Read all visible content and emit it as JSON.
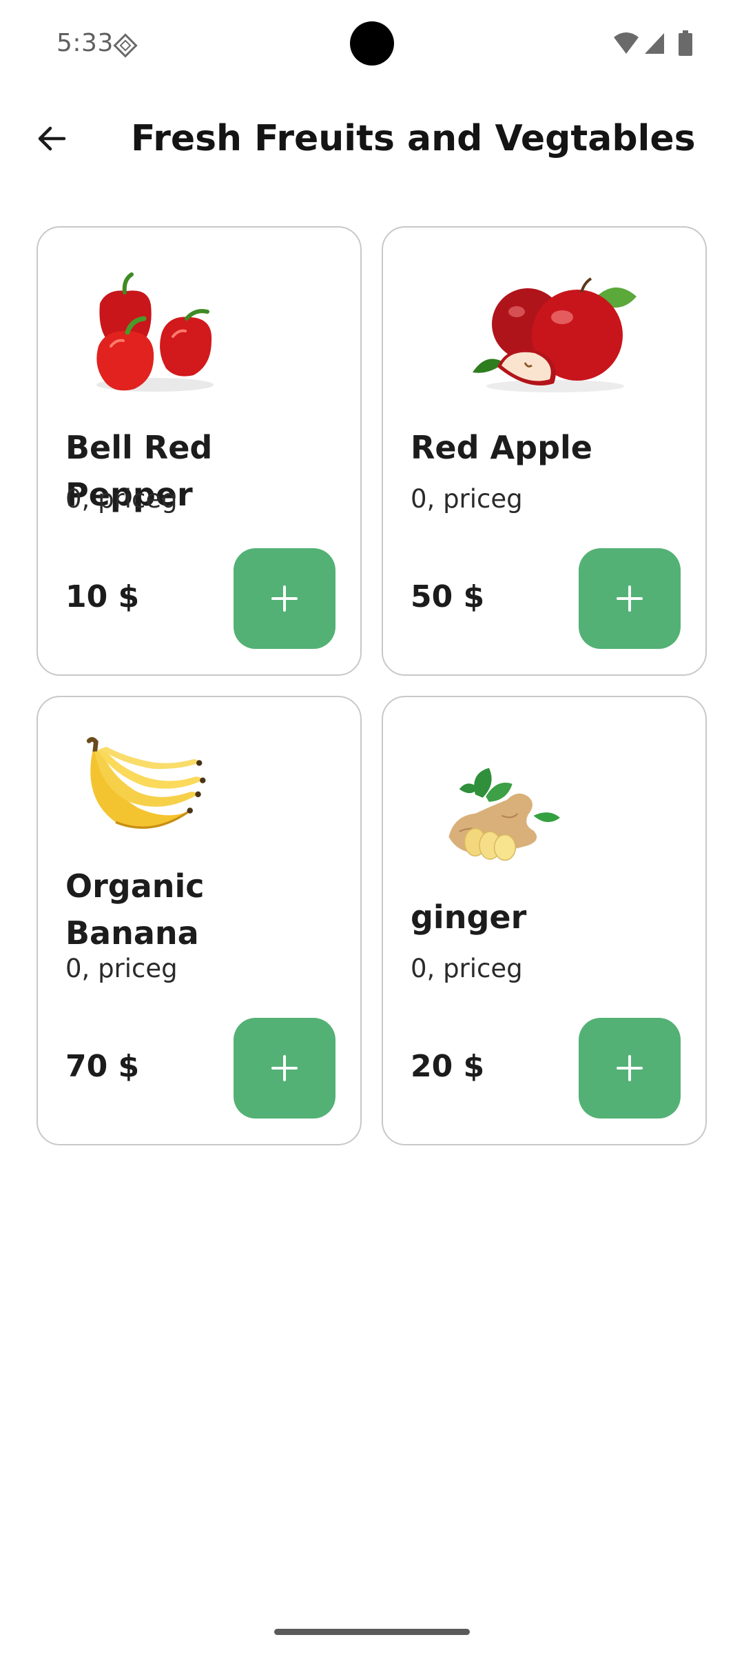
{
  "status_bar": {
    "time": "5:33",
    "icons": [
      "diamond-icon",
      "wifi-icon",
      "signal-icon",
      "battery-icon"
    ]
  },
  "header": {
    "title": "Fresh Freuits and Vegtables",
    "back_icon": "arrow-left-icon"
  },
  "colors": {
    "accent": "#53b175",
    "text": "#1c1c1c",
    "card_border": "#c8c8c8"
  },
  "products": [
    {
      "name": "Bell Red Pepper",
      "unit": "0, priceg",
      "price": "10 $",
      "image": "red-pepper-image",
      "add_icon": "plus-icon"
    },
    {
      "name": "Red Apple",
      "unit": "0, priceg",
      "price": "50 $",
      "image": "red-apple-image",
      "add_icon": "plus-icon"
    },
    {
      "name": "Organic Banana",
      "unit": "0, priceg",
      "price": "70 $",
      "image": "banana-image",
      "add_icon": "plus-icon"
    },
    {
      "name": "ginger",
      "unit": "0, priceg",
      "price": "20 $",
      "image": "ginger-image",
      "add_icon": "plus-icon"
    }
  ]
}
